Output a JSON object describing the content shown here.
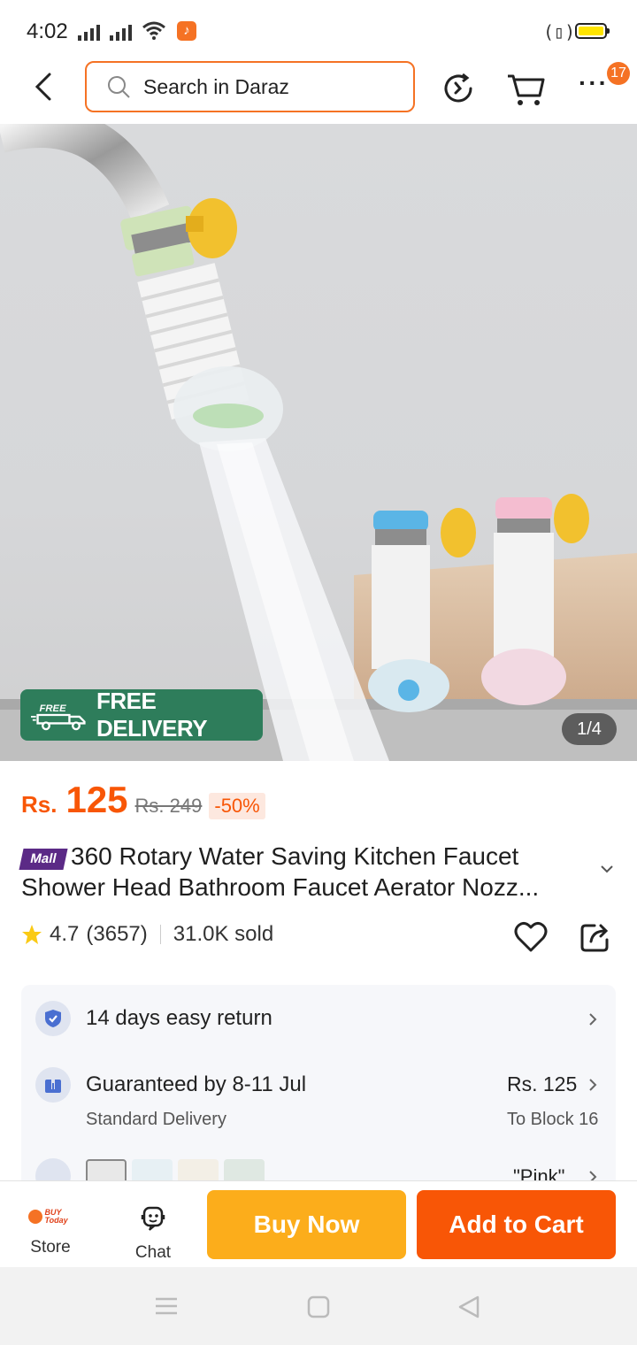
{
  "status_bar": {
    "time": "4:02",
    "battery_color": "#ffe500"
  },
  "header": {
    "search_placeholder": "Search in Daraz",
    "cart_badge": "17",
    "icons": [
      "back-arrow-icon",
      "search-icon",
      "history-icon",
      "cart-icon",
      "more-icon"
    ]
  },
  "hero": {
    "free_delivery_tag": "FREE",
    "free_delivery_label": "FREE DELIVERY",
    "image_counter": "1/4"
  },
  "price": {
    "currency": "Rs.",
    "amount": "125",
    "original": "Rs. 249",
    "discount": "-50%",
    "accent_color": "#f85606"
  },
  "product": {
    "mall_badge": "Mall",
    "title": "360 Rotary Water Saving Kitchen Faucet Shower Head Bathroom Faucet Aerator Nozz...",
    "rating": "4.7",
    "reviews": "(3657)",
    "sold": "31.0K sold"
  },
  "info": {
    "return_text": "14 days easy return",
    "delivery_title": "Guaranteed by 8-11 Jul",
    "delivery_type": "Standard Delivery",
    "delivery_price": "Rs. 125",
    "delivery_location": "To Block 16",
    "variant_selected": "\"Pink\""
  },
  "bottom_bar": {
    "store_label": "Store",
    "store_logo_text": "BUY Today",
    "chat_label": "Chat",
    "buy_now_label": "Buy Now",
    "add_to_cart_label": "Add to Cart",
    "buy_now_color": "#fcad1b",
    "add_to_cart_color": "#f85606"
  }
}
